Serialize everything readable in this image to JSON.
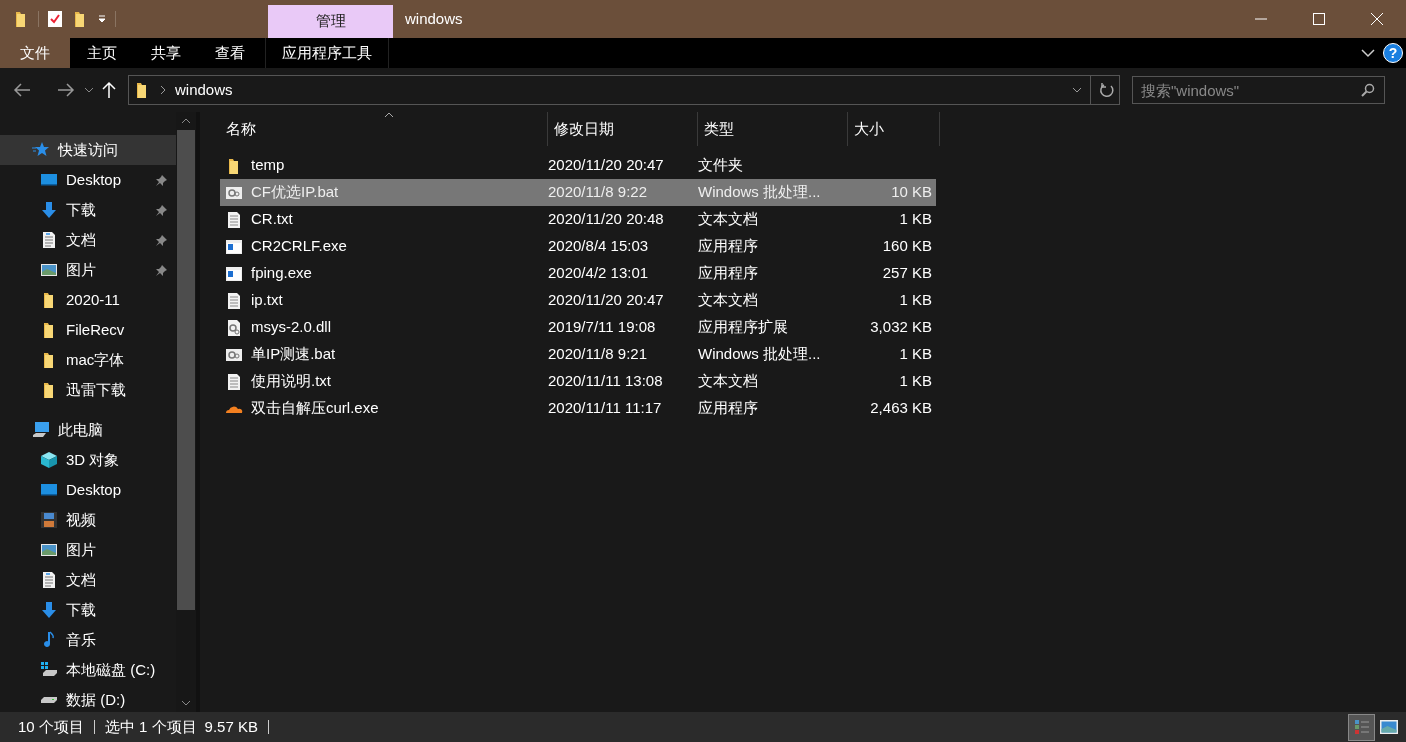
{
  "title_bar": {
    "context_tab": "管理",
    "title": "windows"
  },
  "ribbon_tabs": [
    {
      "label": "文件",
      "kind": "file"
    },
    {
      "label": "主页",
      "kind": "tab"
    },
    {
      "label": "共享",
      "kind": "tab"
    },
    {
      "label": "查看",
      "kind": "tab"
    },
    {
      "label": "应用程序工具",
      "kind": "context"
    }
  ],
  "help_button": "?",
  "address_bar": {
    "path": [
      "windows"
    ],
    "search_placeholder": "搜索\"windows\""
  },
  "nav_pane": [
    {
      "label": "快速访问",
      "kind": "star",
      "selected": true,
      "children": [
        {
          "label": "Desktop",
          "kind": "desktop",
          "pinned": true,
          "selected": false
        },
        {
          "label": "下载",
          "kind": "download",
          "pinned": true,
          "selected": false
        },
        {
          "label": "文档",
          "kind": "document",
          "pinned": true,
          "selected": false
        },
        {
          "label": "图片",
          "kind": "picture",
          "pinned": true,
          "selected": false
        },
        {
          "label": "2020-11",
          "kind": "folder",
          "pinned": false,
          "selected": false
        },
        {
          "label": "FileRecv",
          "kind": "folder",
          "pinned": false,
          "selected": false
        },
        {
          "label": "mac字体",
          "kind": "folder",
          "pinned": false,
          "selected": false
        },
        {
          "label": "迅雷下载",
          "kind": "folder",
          "pinned": false,
          "selected": false
        }
      ]
    },
    {
      "label": "此电脑",
      "kind": "computer",
      "selected": false,
      "children": [
        {
          "label": "3D 对象",
          "kind": "cube",
          "pinned": false,
          "selected": false
        },
        {
          "label": "Desktop",
          "kind": "desktop",
          "pinned": false,
          "selected": false
        },
        {
          "label": "视频",
          "kind": "video",
          "pinned": false,
          "selected": false
        },
        {
          "label": "图片",
          "kind": "picture",
          "pinned": false,
          "selected": false
        },
        {
          "label": "文档",
          "kind": "document",
          "pinned": false,
          "selected": false
        },
        {
          "label": "下载",
          "kind": "download",
          "pinned": false,
          "selected": false
        },
        {
          "label": "音乐",
          "kind": "music",
          "pinned": false,
          "selected": false
        },
        {
          "label": "本地磁盘 (C:)",
          "kind": "drive-c",
          "pinned": false,
          "selected": false
        },
        {
          "label": "数据 (D:)",
          "kind": "drive",
          "pinned": false,
          "selected": false
        }
      ]
    }
  ],
  "table": {
    "columns": [
      {
        "label": "名称",
        "sorted": true
      },
      {
        "label": "修改日期",
        "sorted": false
      },
      {
        "label": "类型",
        "sorted": false
      },
      {
        "label": "大小",
        "sorted": false
      }
    ],
    "rows": [
      {
        "name": "temp",
        "date": "2020/11/20 20:47",
        "type": "文件夹",
        "kind": "folder",
        "selected": false
      },
      {
        "name": "CF优选IP.bat",
        "date": "2020/11/8 9:22",
        "type": "Windows 批处理...",
        "size": "10 KB",
        "kind": "bat",
        "selected": true
      },
      {
        "name": "CR.txt",
        "date": "2020/11/20 20:48",
        "type": "文本文档",
        "size": "1 KB",
        "kind": "txt",
        "selected": false
      },
      {
        "name": "CR2CRLF.exe",
        "date": "2020/8/4 15:03",
        "type": "应用程序",
        "size": "160 KB",
        "kind": "exe",
        "selected": false
      },
      {
        "name": "fping.exe",
        "date": "2020/4/2 13:01",
        "type": "应用程序",
        "size": "257 KB",
        "kind": "exe",
        "selected": false
      },
      {
        "name": "ip.txt",
        "date": "2020/11/20 20:47",
        "type": "文本文档",
        "size": "1 KB",
        "kind": "txt",
        "selected": false
      },
      {
        "name": "msys-2.0.dll",
        "date": "2019/7/11 19:08",
        "type": "应用程序扩展",
        "size": "3,032 KB",
        "kind": "dll",
        "selected": false
      },
      {
        "name": "单IP测速.bat",
        "date": "2020/11/8 9:21",
        "type": "Windows 批处理...",
        "size": "1 KB",
        "kind": "bat",
        "selected": false
      },
      {
        "name": "使用说明.txt",
        "date": "2020/11/11 13:08",
        "type": "文本文档",
        "size": "1 KB",
        "kind": "txt",
        "selected": false
      },
      {
        "name": "双击自解压curl.exe",
        "date": "2020/11/11 11:17",
        "type": "应用程序",
        "size": "2,463 KB",
        "kind": "cloud",
        "selected": false
      }
    ]
  },
  "status_bar": {
    "items": [
      "10 个项目",
      "选中 1 个项目",
      "9.57 KB"
    ],
    "views": [
      {
        "kind": "details",
        "selected": true
      },
      {
        "kind": "large-icons",
        "selected": false
      }
    ]
  }
}
